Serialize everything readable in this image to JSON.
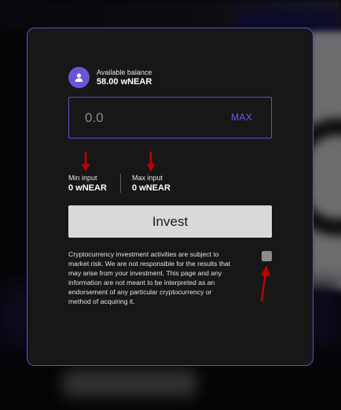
{
  "balance": {
    "label": "Available balance",
    "value": "58.00 wNEAR",
    "icon": "user-icon"
  },
  "amount_input": {
    "value": "",
    "placeholder": "0.0",
    "max_label": "MAX"
  },
  "limits": {
    "min_label": "Min input",
    "min_value": "0 wNEAR",
    "max_label": "Max input",
    "max_value": "0 wNEAR"
  },
  "invest_label": "Invest",
  "disclaimer": "Cryptocurrency investment activities are subject to market risk. We are not responsible for the results that may arise from your investment. This page and any information are not meant to be interpreted as an endorsement of any particular cryptocurrency or method of acquiring it.",
  "colors": {
    "accent": "#5a4fd1",
    "avatar": "#6a55d9",
    "max": "#6b5cf0",
    "annotation_arrow": "#c00000"
  }
}
